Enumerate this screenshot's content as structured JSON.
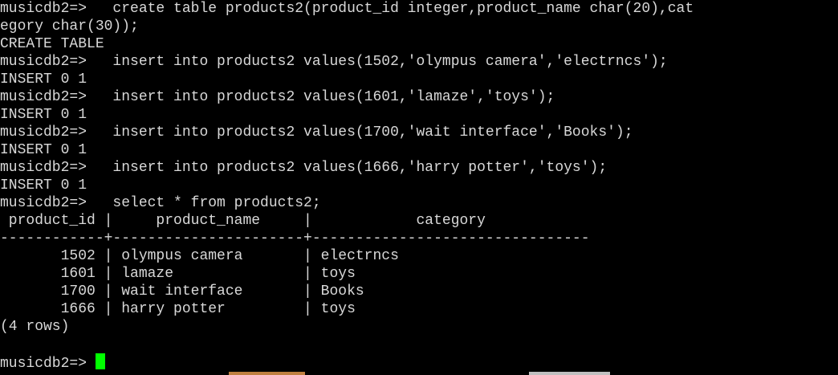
{
  "terminal": {
    "background": "#000000",
    "foreground": "#d8d8d8",
    "cursor_color": "#00ff00",
    "lines": [
      "musicdb2=>   create table products2(product_id integer,product_name char(20),cat",
      "egory char(30));",
      "CREATE TABLE",
      "musicdb2=>   insert into products2 values(1502,'olympus camera','electrncs');",
      "INSERT 0 1",
      "musicdb2=>   insert into products2 values(1601,'lamaze','toys');",
      "INSERT 0 1",
      "musicdb2=>   insert into products2 values(1700,'wait interface','Books');",
      "INSERT 0 1",
      "musicdb2=>   insert into products2 values(1666,'harry potter','toys');",
      "INSERT 0 1",
      "musicdb2=>   select * from products2;",
      " product_id |     product_name     |            category",
      "------------+----------------------+--------------------------------",
      "       1502 | olympus camera       | electrncs",
      "       1601 | lamaze               | toys",
      "       1700 | wait interface       | Books",
      "       1666 | harry potter         | toys",
      "(4 rows)",
      "",
      "musicdb2=> "
    ]
  },
  "taskbar_strip": {
    "colors": [
      "#c08040",
      "#c0c0c0"
    ]
  }
}
